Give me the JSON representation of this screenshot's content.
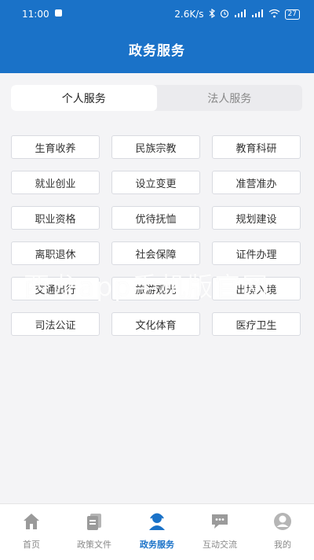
{
  "status": {
    "time": "11:00",
    "speed": "2.6K/s",
    "battery": "27"
  },
  "header": {
    "title": "政务服务"
  },
  "tabs": [
    {
      "label": "个人服务",
      "active": true
    },
    {
      "label": "法人服务",
      "active": false
    }
  ],
  "services": [
    "生育收养",
    "民族宗教",
    "教育科研",
    "就业创业",
    "设立变更",
    "准营准办",
    "职业资格",
    "优待抚恤",
    "规划建设",
    "离职退休",
    "社会保障",
    "证件办理",
    "交通出行",
    "旅游观光",
    "出境入境",
    "司法公证",
    "文化体育",
    "医疗卫生"
  ],
  "watermark": "西龙app手机版官网",
  "nav": [
    {
      "label": "首页",
      "icon": "home-icon",
      "active": false
    },
    {
      "label": "政策文件",
      "icon": "document-icon",
      "active": false
    },
    {
      "label": "政务服务",
      "icon": "service-person-icon",
      "active": true
    },
    {
      "label": "互动交流",
      "icon": "chat-icon",
      "active": false
    },
    {
      "label": "我的",
      "icon": "profile-icon",
      "active": false
    }
  ],
  "colors": {
    "primary": "#1a72c8",
    "active_nav": "#1a72c8",
    "inactive_nav": "#999999"
  }
}
